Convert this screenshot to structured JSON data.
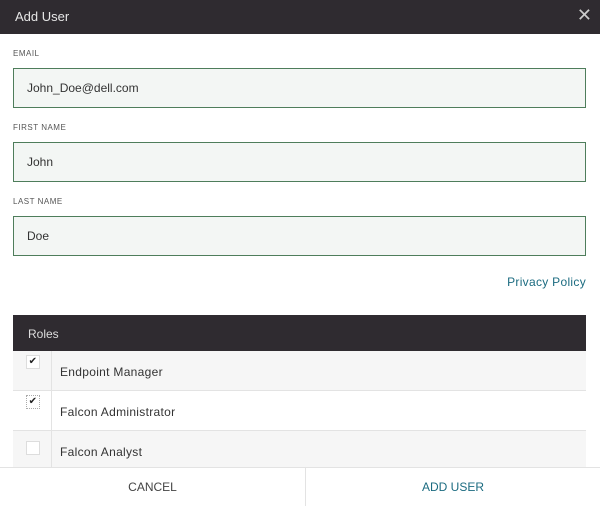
{
  "dialog": {
    "title": "Add User"
  },
  "form": {
    "email": {
      "label": "EMAIL",
      "value": "John_Doe@dell.com"
    },
    "first_name": {
      "label": "FIRST NAME",
      "value": "John"
    },
    "last_name": {
      "label": "LAST NAME",
      "value": "Doe"
    },
    "privacy_link": "Privacy Policy"
  },
  "roles": {
    "header": "Roles",
    "items": [
      {
        "label": "Endpoint Manager",
        "checked": true
      },
      {
        "label": "Falcon Administrator",
        "checked": true
      },
      {
        "label": "Falcon Analyst",
        "checked": false
      }
    ]
  },
  "footer": {
    "cancel": "CANCEL",
    "add": "ADD USER"
  }
}
